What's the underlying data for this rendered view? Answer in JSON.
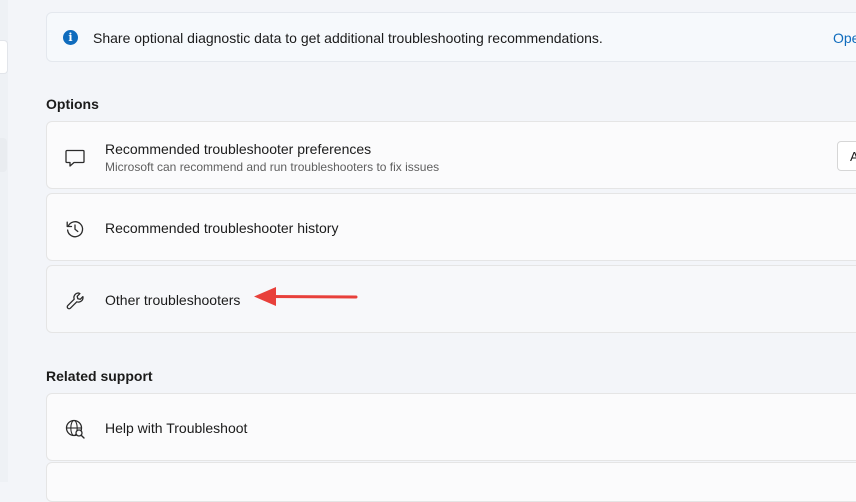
{
  "infobar": {
    "text": "Share optional diagnostic data to get additional troubleshooting recommendations.",
    "link": "Ope",
    "icon": "info-icon"
  },
  "options": {
    "heading": "Options",
    "items": [
      {
        "title": "Recommended troubleshooter preferences",
        "subtitle": "Microsoft can recommend and run troubleshooters to fix issues",
        "icon": "chat-bubble-icon",
        "dropdown_value": "A"
      },
      {
        "title": "Recommended troubleshooter history",
        "icon": "history-icon"
      },
      {
        "title": "Other troubleshooters",
        "icon": "wrench-icon"
      }
    ]
  },
  "related": {
    "heading": "Related support",
    "items": [
      {
        "title": "Help with Troubleshoot",
        "icon": "globe-search-icon"
      }
    ]
  },
  "colors": {
    "accent": "#0f6cbd",
    "annotation_arrow": "#e8403a",
    "background": "#f3f5f9",
    "card": "#fbfbfc"
  }
}
